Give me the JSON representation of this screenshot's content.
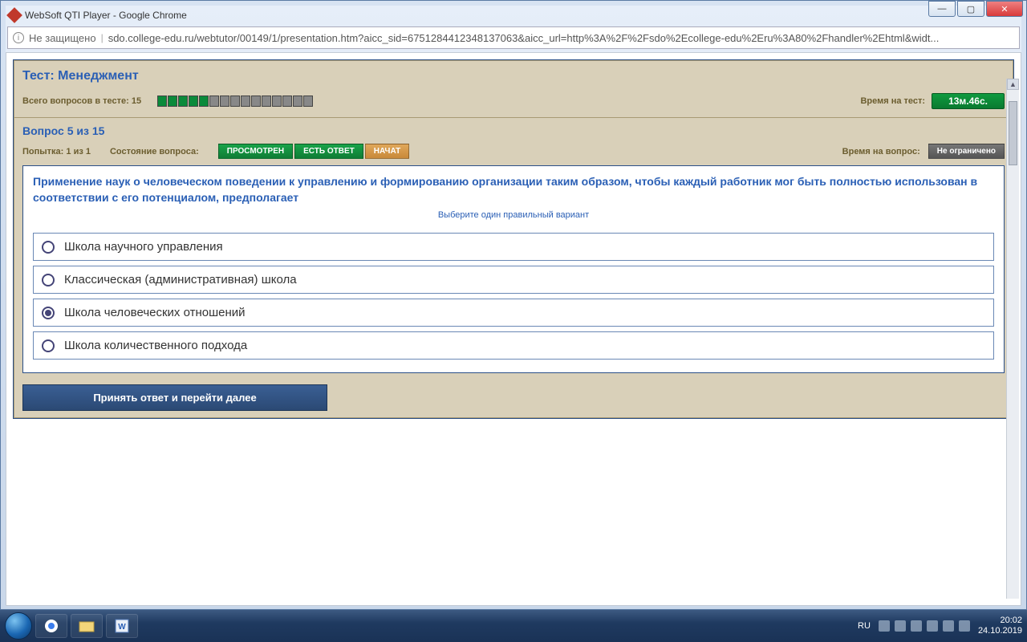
{
  "window": {
    "title": "WebSoft QTI Player - Google Chrome",
    "min": "—",
    "max": "▢",
    "close": "✕"
  },
  "address": {
    "not_secure": "Не защищено",
    "url": "sdo.college-edu.ru/webtutor/00149/1/presentation.htm?aicc_sid=6751284412348137063&aicc_url=http%3A%2F%2Fsdo%2Ecollege-edu%2Eru%3A80%2Fhandler%2Ehtml&widt..."
  },
  "test": {
    "title": "Тест: Менеджмент",
    "total_q_label": "Всего вопросов в тесте: 15",
    "progress_done": 5,
    "progress_total": 15,
    "time_label": "Время на тест:",
    "time_value": "13м.46с."
  },
  "question": {
    "header": "Вопрос 5 из 15",
    "attempt": "Попытка: 1 из 1",
    "state_label": "Состояние вопроса:",
    "badges": {
      "viewed": "ПРОСМОТРЕН",
      "answered": "ЕСТЬ ОТВЕТ",
      "started": "НАЧАТ"
    },
    "qtime_label": "Время на вопрос:",
    "qtime_value": "Не ограничено",
    "text": "Применение наук о человеческом поведении к управлению и формированию организации таким образом, чтобы каждый работник мог быть полностью использован в соответствии с его потенциалом, предполагает",
    "instruction": "Выберите один правильный вариант",
    "options": [
      {
        "label": "Школа научного управления",
        "selected": false
      },
      {
        "label": "Классическая (административная) школа",
        "selected": false
      },
      {
        "label": "Школа человеческих отношений",
        "selected": true
      },
      {
        "label": "Школа количественного подхода",
        "selected": false
      }
    ],
    "submit": "Принять ответ и перейти далее"
  },
  "taskbar": {
    "lang": "RU",
    "time": "20:02",
    "date": "24.10.2019"
  }
}
